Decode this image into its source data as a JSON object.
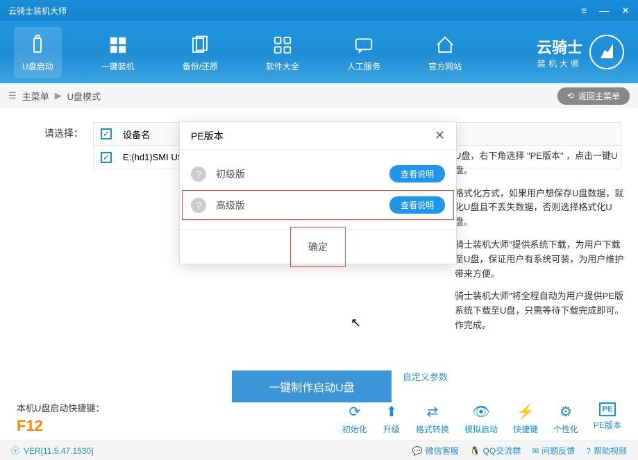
{
  "titlebar": {
    "title": "云骑士装机大师"
  },
  "nav": [
    {
      "label": "U盘启动"
    },
    {
      "label": "一键装机"
    },
    {
      "label": "备份/还原"
    },
    {
      "label": "软件大全"
    },
    {
      "label": "人工服务"
    },
    {
      "label": "官方网站"
    }
  ],
  "brand": {
    "main": "云骑士",
    "sub": "装机大师"
  },
  "breadcrumb": {
    "root": "主菜单",
    "current": "U盘模式",
    "back": "返回主菜单"
  },
  "selectLabel": "请选择：",
  "tableHeader": "设备名",
  "tableRow": "E:(hd1)SMI US",
  "mainBtn": "一键制作启动U盘",
  "customLink": "自定义参数",
  "rightText": {
    "p1": "U盘，右下角选择 \"PE版本\" ，点击一键U盘。",
    "p2": "格式化方式，如果用户想保存U盘数据，就化U盘且不丢失数据，否则选择格式化U盘。",
    "p3": "骑士装机大师\"提供系统下载，为用户下载至U盘，保证用户有系统可装，为用户维护带来方便。",
    "p4": "骑士装机大师\"将全程自动为用户提供PE版系统下载至U盘，只需等待下载完成即可。作完成。"
  },
  "footerInfo": {
    "label": "本机U盘启动快捷键：",
    "key": "F12"
  },
  "tools": [
    {
      "label": "初始化"
    },
    {
      "label": "升级"
    },
    {
      "label": "格式转换"
    },
    {
      "label": "模拟启动"
    },
    {
      "label": "快捷键"
    },
    {
      "label": "个性化"
    },
    {
      "label": "PE版本"
    }
  ],
  "statusbar": {
    "version": "VER[11.5.47.1530]",
    "items": [
      "微信客服",
      "QQ交流群",
      "问题反馈",
      "帮助视频"
    ]
  },
  "modal": {
    "title": "PE版本",
    "rows": [
      {
        "label": "初级版",
        "btn": "查看说明"
      },
      {
        "label": "高级版",
        "btn": "查看说明"
      }
    ],
    "confirm": "确定"
  }
}
